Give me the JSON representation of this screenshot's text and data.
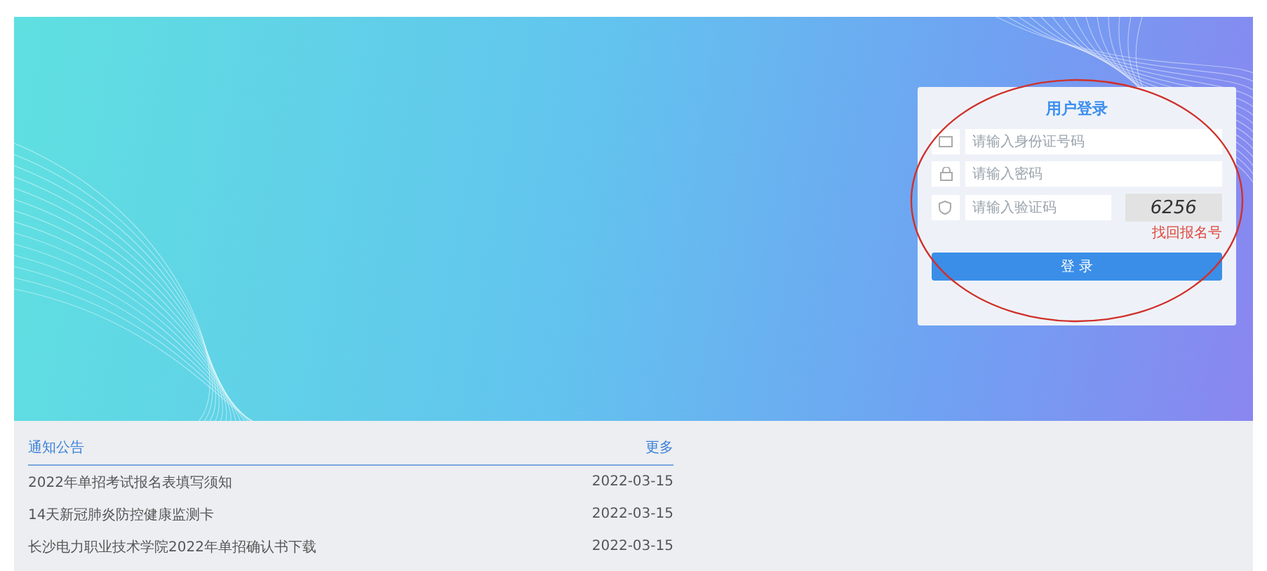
{
  "login": {
    "title": "用户登录",
    "fields": [
      {
        "kind": "id",
        "placeholder": "请输入身份证号码"
      },
      {
        "kind": "password",
        "placeholder": "请输入密码"
      },
      {
        "kind": "captcha",
        "placeholder": "请输入验证码"
      }
    ],
    "captcha": "6256",
    "recover_link": "找回报名号",
    "submit": "登 录"
  },
  "notices": {
    "title": "通知公告",
    "more": "更多",
    "items": [
      {
        "title": "2022年单招考试报名表填写须知",
        "date": "2022-03-15"
      },
      {
        "title": "14天新冠肺炎防控健康监测卡",
        "date": "2022-03-15"
      },
      {
        "title": "长沙电力职业技术学院2022年单招确认书下载",
        "date": "2022-03-15"
      }
    ]
  }
}
